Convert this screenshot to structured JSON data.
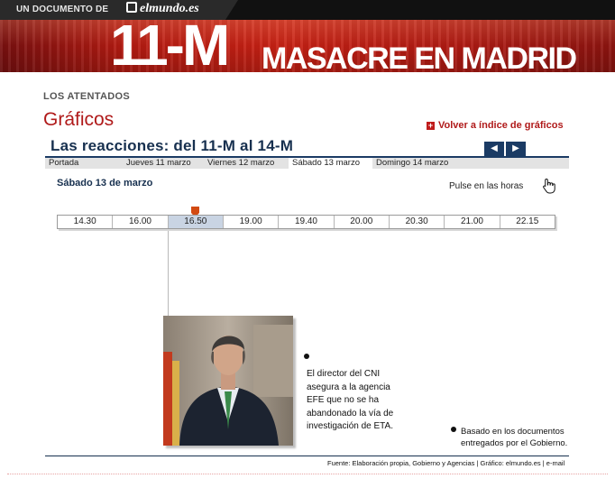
{
  "topbar": {
    "label": "UN DOCUMENTO DE",
    "logo": "elmundo.es"
  },
  "banner": {
    "big": "11-M",
    "sub": "MASACRE EN MADRID"
  },
  "section_label": "LOS ATENTADOS",
  "page_title": "Gráficos",
  "back_link": "Volver a índice de gráficos",
  "heading": "Las reacciones: del 11-M al 14-M",
  "nav": {
    "tabs": [
      {
        "label": "Portada"
      },
      {
        "label": "Jueves 11 marzo"
      },
      {
        "label": "Viernes 12 marzo"
      },
      {
        "label": "Sábado 13 marzo"
      },
      {
        "label": "Domingo 14 marzo"
      }
    ],
    "active": "Sábado 13 marzo",
    "prev_arrow": "◀",
    "next_arrow": "▶"
  },
  "date": "Sábado 13 de marzo",
  "hint": "Pulse en las horas",
  "timeline": {
    "hours": [
      "14.30",
      "16.00",
      "16.50",
      "19.00",
      "19.40",
      "20.00",
      "20.30",
      "21.00",
      "22.15"
    ],
    "active": "16.50"
  },
  "caption": "El director del CNI asegura a la agencia EFE que no se ha abandonado la vía de investigación de ETA.",
  "source_note": "Basado en los documentos entregados por el Gobierno.",
  "footer": "Fuente: Elaboración propia, Gobierno y Agencias | Gráfico: elmundo.es | e-mail",
  "colors": {
    "accent_red": "#b01a1a",
    "navy": "#17304f",
    "banner_red": "#c92114"
  }
}
